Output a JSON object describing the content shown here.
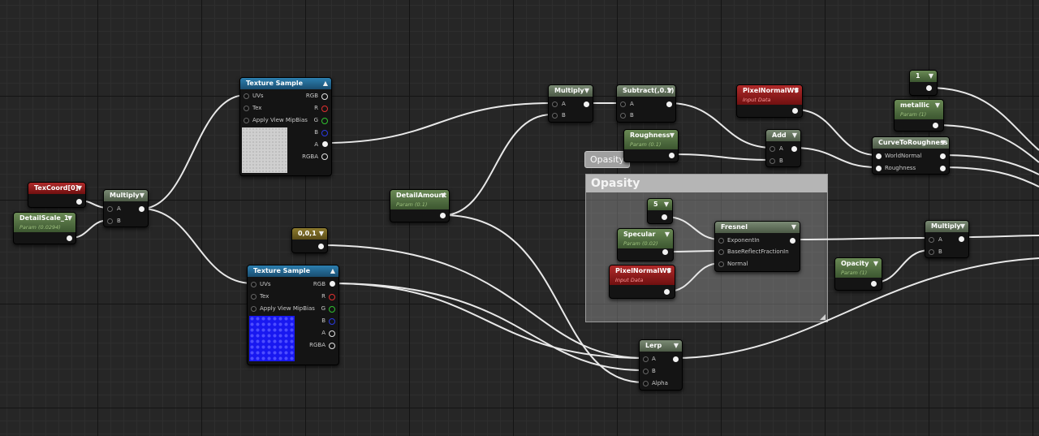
{
  "editor": {
    "comment": {
      "title": "Opasity",
      "bubble": "Opasity"
    },
    "nodes": {
      "texcoord": {
        "title": "TexCoord[0]"
      },
      "detailscale": {
        "title": "DetailScale_1",
        "subtitle": "Param (0.0294)"
      },
      "multiply1": {
        "title": "Multiply",
        "pins": [
          "A",
          "B"
        ]
      },
      "texsample1": {
        "title": "Texture Sample",
        "inputs": [
          "UVs",
          "Tex",
          "Apply View MipBias"
        ],
        "outputs": [
          "RGB",
          "R",
          "G",
          "B",
          "A",
          "RGBA"
        ]
      },
      "texsample2": {
        "title": "Texture Sample",
        "inputs": [
          "UVs",
          "Tex",
          "Apply View MipBias"
        ],
        "outputs": [
          "RGB",
          "R",
          "G",
          "B",
          "A",
          "RGBA"
        ]
      },
      "const001": {
        "title": "0,0,1"
      },
      "detailamount": {
        "title": "DetailAmount",
        "subtitle": "Param (0.1)"
      },
      "multiply2": {
        "title": "Multiply",
        "pins": [
          "A",
          "B"
        ]
      },
      "subtract": {
        "title": "Subtract(,0.1)",
        "pins": [
          "A",
          "B"
        ]
      },
      "roughness": {
        "title": "Roughness",
        "subtitle": "Param (0.1)"
      },
      "pixelnormal1": {
        "title": "PixelNormalWS",
        "subtitle": "Input Data"
      },
      "add": {
        "title": "Add",
        "pins": [
          "A",
          "B"
        ]
      },
      "curve": {
        "title": "CurveToRoughness",
        "pins": [
          "WorldNormal",
          "Roughness"
        ]
      },
      "const1": {
        "title": "1"
      },
      "metallic": {
        "title": "metallic",
        "subtitle": "Param (1)"
      },
      "const5": {
        "title": "5"
      },
      "specular": {
        "title": "Specular",
        "subtitle": "Param (0.02)"
      },
      "pixelnormal2": {
        "title": "PixelNormalWS",
        "subtitle": "Input Data"
      },
      "fresnel": {
        "title": "Fresnel",
        "pins": [
          "ExponentIn",
          "BaseReflectFractionIn",
          "Normal"
        ]
      },
      "multiply3": {
        "title": "Multiply",
        "pins": [
          "A",
          "B"
        ]
      },
      "opacity": {
        "title": "Opacity",
        "subtitle": "Param (1)"
      },
      "lerp": {
        "title": "Lerp",
        "pins": [
          "A",
          "B",
          "Alpha"
        ]
      }
    }
  },
  "colors": {
    "background": "#262626",
    "param_header": "#4a6a3a",
    "input_header": "#8a1a1a",
    "texture_header": "#2a6a98",
    "constant_header": "#7a6a22"
  }
}
